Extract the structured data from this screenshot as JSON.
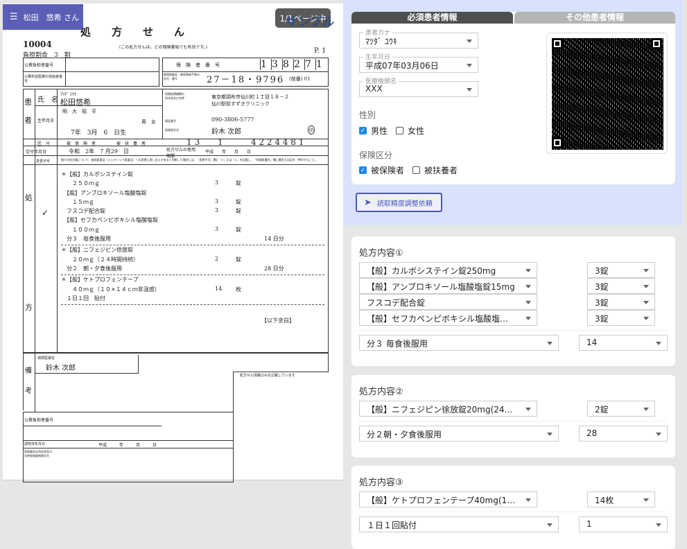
{
  "header": {
    "patient_button": "松田　悠希 さん",
    "page_indicator": "1/1ページ中",
    "watermark": "サンプル"
  },
  "prescription_image": {
    "title": "処　　方　　せ　　ん",
    "number": "10004",
    "note": "(この処方せんは、どの保険薬局でも有効です。)",
    "burden": "負担割合　3　割",
    "page": "P. 1",
    "public_payer_label": "公費負担者番号",
    "public_recipient_label": "公費負担医療の受給者番号",
    "insurer_label": "保　険　者　番　号",
    "insurer_digits": [
      "1",
      "3",
      "8",
      "2",
      "7",
      "1"
    ],
    "card_label": "被保険者証・被保険者手帳の記号・番号",
    "card_number": "27－18・9796",
    "branch": "(枝番) 01",
    "patient_side": "患　者",
    "name_label": "氏　名",
    "kana": "ﾏﾂﾀﾞ ﾕｳｷ",
    "name": "松田悠希",
    "birth_label": "生年月日",
    "eras": "明　大　昭　平",
    "birth": "7年　3月　6　日生",
    "sex": "男　女",
    "category_label": "区　分",
    "insured": "被　保　険　者",
    "dependent": "被　扶　養　者",
    "clinic_label": "保険医療機関の所在地及び名称",
    "clinic_address": "東京都調布市仙川町１丁目１８－２",
    "clinic_name": "仙川駅前すずきクリニック",
    "phone_label": "電話番号",
    "phone": "090-3806-5777",
    "doctor_label": "保険医氏名",
    "doctor": "鈴木 次郎",
    "seal": "印",
    "pref_code": "1  3",
    "score_code": "1",
    "institution_code": "4 2 2 4 4 8 1",
    "issue_label": "交付年月日",
    "issue_date": "令和　2年　7 月29　日",
    "validity_label": "処方せんの使用期間",
    "validity": "平成　　年　　月　　日",
    "rx_side_top": "処",
    "rx_side_bottom": "方",
    "change_label": "変更不可",
    "check": "✓",
    "change_note": "個々の処方薬について、後発医薬品（ジェネリック医薬品）への変更に差し支えがあると判断した場合には、「変更不可」欄に「✓」又は「×」を記載し、「保険医署名」欄に署名又は記名・押印すること。",
    "lines": [
      {
        "drug": "＊【般】カルボシステイン錠",
        "dose": "",
        "unit": ""
      },
      {
        "drug": "　　２５０ｍｇ",
        "dose": "3",
        "unit": "錠"
      },
      {
        "drug": "　【般】アンブロキソール塩酸塩錠",
        "dose": "",
        "unit": ""
      },
      {
        "drug": "　　１５ｍｇ",
        "dose": "3",
        "unit": "錠"
      },
      {
        "drug": "　フスコデ配合錠",
        "dose": "3",
        "unit": "錠"
      },
      {
        "drug": "　【般】セフカペンピボキシル塩酸塩錠",
        "dose": "",
        "unit": ""
      },
      {
        "drug": "　　１００ｍｇ",
        "dose": "3",
        "unit": "錠"
      },
      {
        "drug": "　分３　毎食後服用",
        "dose": "",
        "unit": "",
        "days": "14 日分"
      },
      {
        "drug": "＊【般】ニフェジピン徐放錠",
        "dose": "",
        "unit": ""
      },
      {
        "drug": "　　２０ｍｇ（２４時間持続）",
        "dose": "2",
        "unit": "錠"
      },
      {
        "drug": "　分２　朝・夕食後服用",
        "dose": "",
        "unit": "",
        "days": "28 日分"
      },
      {
        "drug": "＊【般】ケトプロフェンテープ",
        "dose": "",
        "unit": ""
      },
      {
        "drug": "　　４０ｍｇ（１０×１４ｃｍ非温感）",
        "dose": "14",
        "unit": "枚"
      },
      {
        "drug": "　１日１回　貼付",
        "dose": "",
        "unit": ""
      }
    ],
    "blank_below": "【以下余白】",
    "remarks_top": "備",
    "remarks_bottom": "考",
    "signature_label": "保険医署名",
    "signature": "鈴木 次郎",
    "info_only": "処方せん情報のみを記載しています",
    "dispense_label": "調剤済年月日",
    "dispense_date": "平成　　　年　　　月　　　日",
    "pharmacy_label": "保険薬局の所在地及び名称保険薬剤師氏名"
  },
  "patient_card": {
    "tabs": [
      {
        "label": "必須患者情報",
        "active": true
      },
      {
        "label": "その他患者情報",
        "active": false
      }
    ],
    "kana": {
      "label": "患者カナ",
      "value": "ﾏﾂﾀﾞ ﾕｳｷ"
    },
    "birth": {
      "label": "生年月日",
      "value": "平成07年03月06日"
    },
    "institution": {
      "label": "医療機関名",
      "value": "XXX"
    },
    "sex": {
      "label": "性別",
      "options": [
        {
          "label": "男性",
          "checked": true
        },
        {
          "label": "女性",
          "checked": false
        }
      ]
    },
    "insurance": {
      "label": "保険区分",
      "options": [
        {
          "label": "被保険者",
          "checked": true
        },
        {
          "label": "被扶養者",
          "checked": false
        }
      ]
    }
  },
  "adjust_button": "読取精度調整依頼",
  "prescriptions": [
    {
      "title": "処方内容①",
      "drugs": [
        {
          "name": "【般】カルボシステイン錠250mg",
          "qty": "3錠"
        },
        {
          "name": "【般】アンブロキソール塩酸塩錠15mg",
          "qty": "3錠"
        },
        {
          "name": "フスコデ配合錠",
          "qty": "3錠"
        },
        {
          "name": "【般】セフカペンピボキシル塩酸塩錠100mg",
          "qty": "3錠"
        }
      ],
      "usage": "分３ 毎食後服用",
      "days": "14"
    },
    {
      "title": "処方内容②",
      "drugs": [
        {
          "name": "【般】ニフェジピン徐放錠20mg(24時間持続)",
          "qty": "2錠"
        }
      ],
      "usage": "分２朝・夕食後服用",
      "days": "28"
    },
    {
      "title": "処方内容③",
      "drugs": [
        {
          "name": "【般】ケトプロフェンテープ40mg(10×14cm非温感)",
          "qty": "14枚"
        }
      ],
      "usage": "１日１回貼付",
      "days": "1"
    }
  ],
  "colors": {
    "menu": "#5a5fb5",
    "tab_active": "#4f4f4f",
    "tab_inactive": "#b5b5b5",
    "top_bg": "#d9e2fb",
    "checkbox": "#1e88e5",
    "button": "#4a56b8"
  }
}
